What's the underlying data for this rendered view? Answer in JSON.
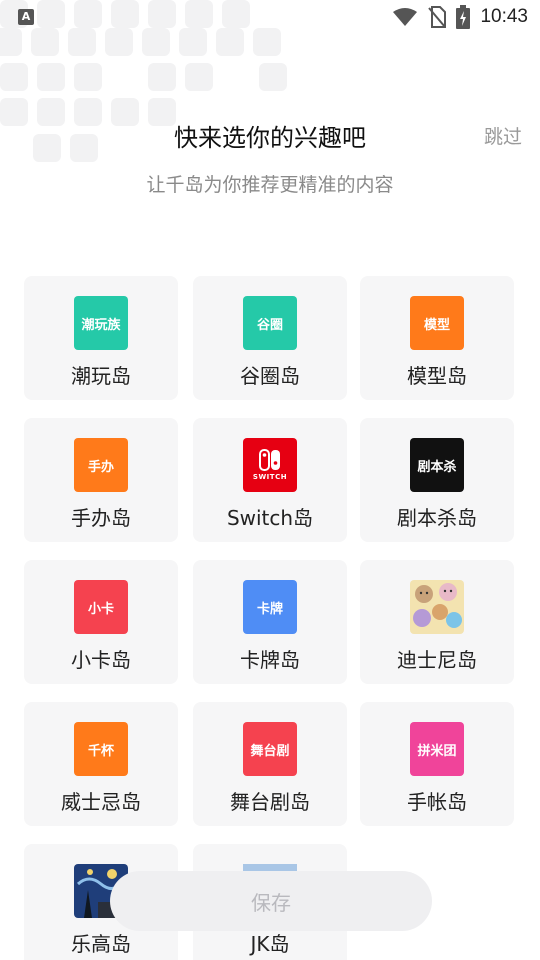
{
  "status": {
    "app_icon_letter": "A",
    "time": "10:43",
    "icons": [
      "wifi-icon",
      "no-sim-icon",
      "battery-charging-icon"
    ]
  },
  "header": {
    "title": "快来选你的兴趣吧",
    "subtitle": "让千岛为你推荐更精准的内容",
    "skip_label": "跳过"
  },
  "interests": [
    {
      "label": "潮玩岛",
      "icon_text": "潮玩族",
      "icon": "chaowan-icon",
      "color": "#25c9a8"
    },
    {
      "label": "谷圈岛",
      "icon_text": "谷圈",
      "icon": "guquan-icon",
      "color": "#25c9a8"
    },
    {
      "label": "模型岛",
      "icon_text": "模型",
      "icon": "moxing-icon",
      "color": "#ff7a1a"
    },
    {
      "label": "手办岛",
      "icon_text": "手办",
      "icon": "shouban-icon",
      "color": "#ff7a1a"
    },
    {
      "label": "Switch岛",
      "icon_text": "SWITCH",
      "icon": "nintendo-switch-icon",
      "color": "#e60012"
    },
    {
      "label": "剧本杀岛",
      "icon_text": "剧本杀",
      "icon": "jubensha-icon",
      "color": "#111111"
    },
    {
      "label": "小卡岛",
      "icon_text": "小卡",
      "icon": "xiaoka-icon",
      "color": "#f5424f"
    },
    {
      "label": "卡牌岛",
      "icon_text": "卡牌",
      "icon": "kapai-icon",
      "color": "#4f8df5"
    },
    {
      "label": "迪士尼岛",
      "icon_text": "",
      "icon": "disney-bears-icon",
      "color": "#f3e3b0"
    },
    {
      "label": "威士忌岛",
      "icon_text": "千杯",
      "icon": "qianbei-icon",
      "color": "#ff7a1a"
    },
    {
      "label": "舞台剧岛",
      "icon_text": "舞台剧",
      "icon": "wutaiju-icon",
      "color": "#f5424f"
    },
    {
      "label": "手帐岛",
      "icon_text": "拼米团",
      "icon": "pinmituan-icon",
      "color": "#f0449a"
    },
    {
      "label": "乐高岛",
      "icon_text": "",
      "icon": "lego-starry-night-icon",
      "color": "#1f3e7a"
    },
    {
      "label": "JK岛",
      "icon_text": "",
      "icon": "jk-photo-icon",
      "color": "#8fb3d9"
    }
  ],
  "save_label": "保存"
}
